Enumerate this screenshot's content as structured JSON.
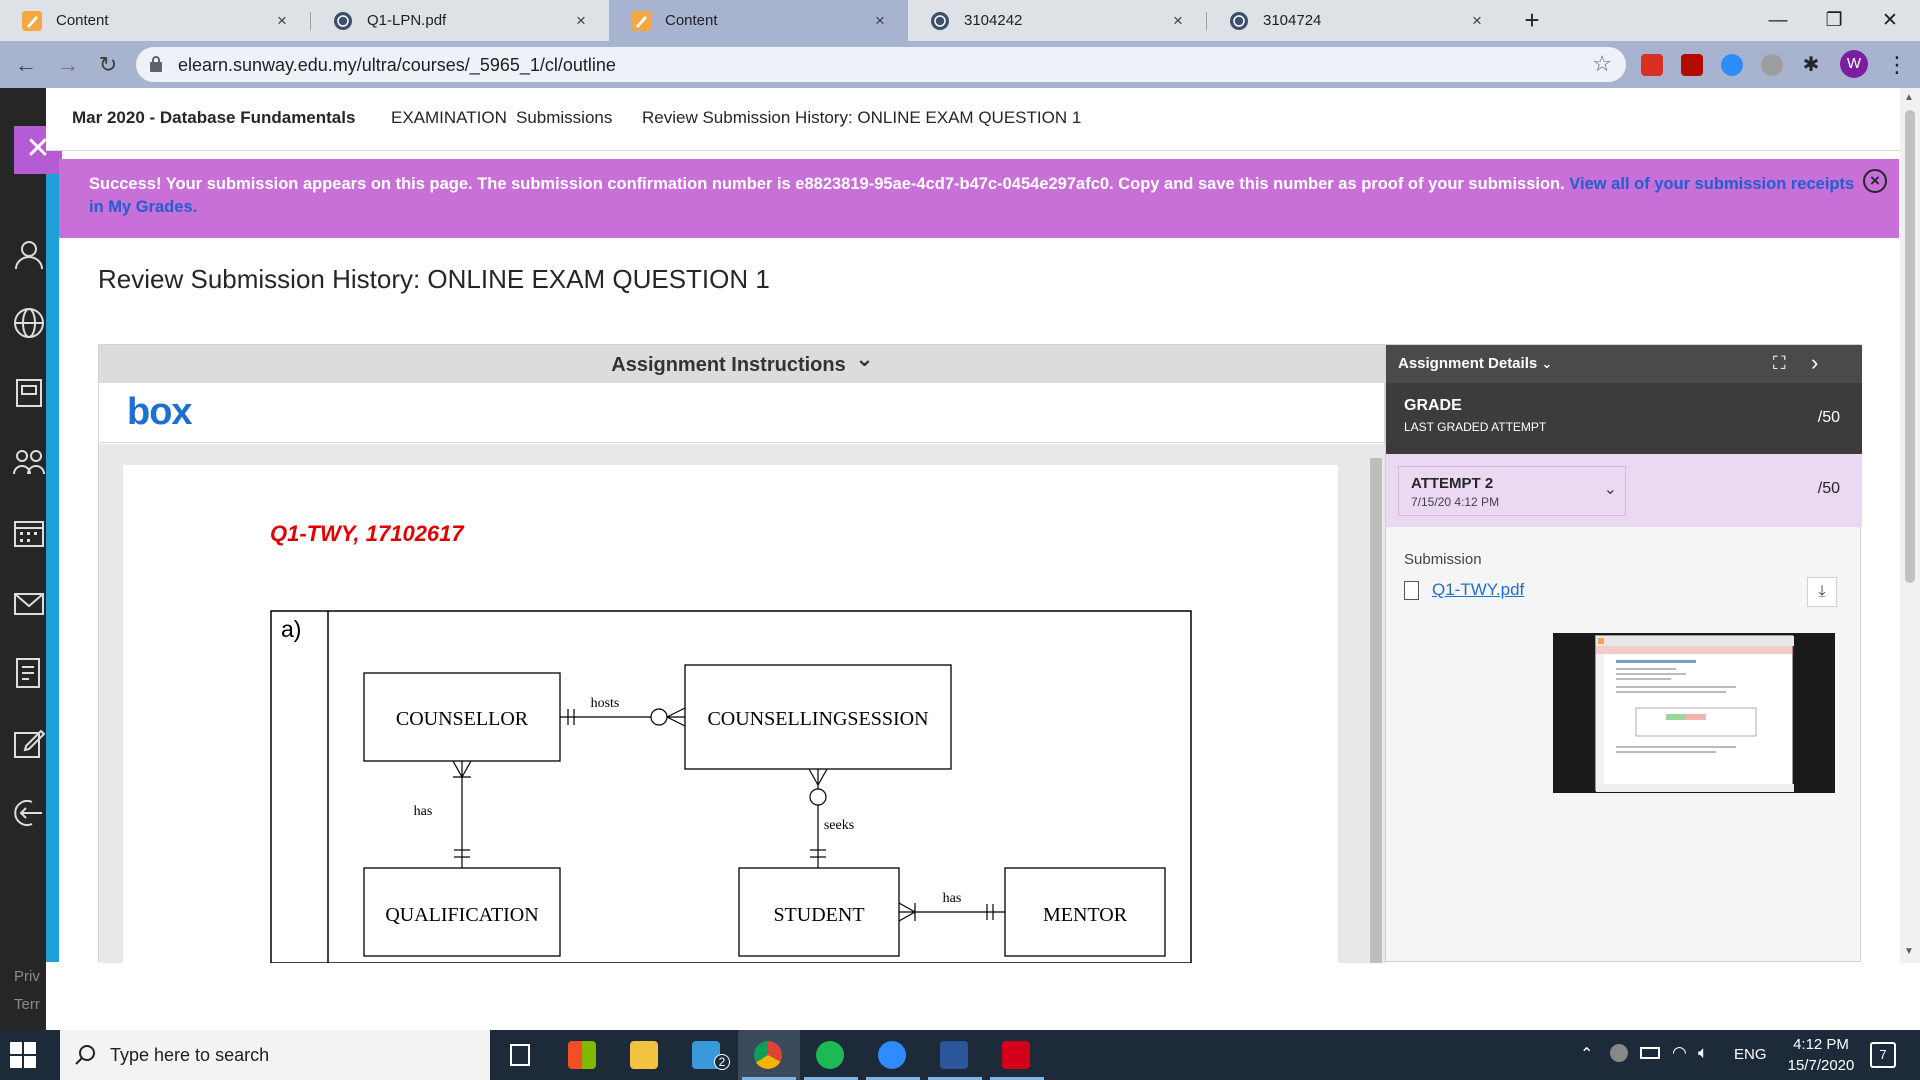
{
  "browser": {
    "tabs": [
      {
        "title": "Content",
        "icon": "blackboard-icon",
        "close": "×"
      },
      {
        "title": "Q1-LPN.pdf",
        "icon": "globe-icon",
        "close": "×"
      },
      {
        "title": "Content",
        "icon": "blackboard-icon",
        "close": "×"
      },
      {
        "title": "3104242",
        "icon": "globe-icon",
        "close": "×"
      },
      {
        "title": "3104724",
        "icon": "globe-icon",
        "close": "×"
      }
    ],
    "new_tab": "+",
    "url": "elearn.sunway.edu.my/ultra/courses/_5965_1/cl/outline",
    "profile_initial": "W",
    "window_controls": {
      "minimize": "—",
      "restore": "❐",
      "close": "✕"
    }
  },
  "breadcrumb": {
    "course": "Mar 2020 - Database Fundamentals",
    "items": [
      "EXAMINATION",
      "Submissions",
      "Review Submission History: ONLINE EXAM QUESTION 1"
    ]
  },
  "banner": {
    "message": "Success! Your submission appears on this page. The submission confirmation number is e8823819-95ae-4cd7-b47c-0454e297afc0. Copy and save this number as proof of your submission.",
    "link": "View all of your submission receipts in My Grades.",
    "close_symbol": "×"
  },
  "page_title": "Review Submission History: ONLINE EXAM QUESTION 1",
  "instructions": {
    "header": "Assignment Instructions",
    "caret": "⌄",
    "box_logo": "box"
  },
  "document": {
    "heading": "Q1-TWY, 17102617",
    "part": "a)",
    "entities": [
      "COUNSELLOR",
      "COUNSELLINGSESSION",
      "QUALIFICATION",
      "STUDENT",
      "MENTOR"
    ],
    "relationships": [
      "hosts",
      "has",
      "seeks",
      "has"
    ]
  },
  "details": {
    "header": "Assignment Details",
    "grade_label": "GRADE",
    "grade_sub": "LAST GRADED ATTEMPT",
    "grade_score": "/50",
    "attempt_label": "ATTEMPT 2",
    "attempt_date": "7/15/20 4:12 PM",
    "attempt_score": "/50",
    "submission_label": "Submission",
    "file_name": "Q1-TWY.pdf"
  },
  "rail": {
    "footer": [
      "Priv",
      "Terr"
    ]
  },
  "taskbar": {
    "search_placeholder": "Type here to search",
    "mail_badge": "2",
    "language": "ENG",
    "time": "4:12 PM",
    "date": "15/7/2020",
    "notification_count": "7"
  },
  "colors": {
    "banner": "#c86fd8",
    "accent_blue": "#1ca0d6",
    "link": "#1f6fd1",
    "doc_heading": "#e00000"
  }
}
